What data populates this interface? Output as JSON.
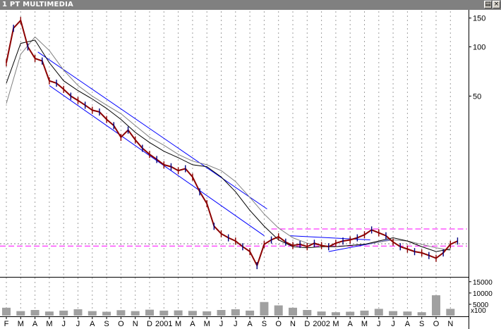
{
  "window": {
    "title": "1 PT MULTIMEDIA",
    "buttons": {
      "minimize": "▤",
      "close": "×"
    }
  },
  "chart_data": {
    "type": "line",
    "title": "1 PT MULTIMEDIA",
    "price_scale": "log",
    "price_ticks": [
      150,
      100,
      50
    ],
    "price_range": [
      4,
      165
    ],
    "volume_ticks": [
      15000,
      10000,
      5000
    ],
    "volume_multiplier_label": "x100",
    "x_labels": [
      "F",
      "M",
      "A",
      "M",
      "J",
      "J",
      "A",
      "S",
      "O",
      "N",
      "D",
      "2001",
      "M",
      "A",
      "M",
      "J",
      "J",
      "A",
      "S",
      "O",
      "N",
      "D",
      "2002",
      "M",
      "A",
      "M",
      "J",
      "J",
      "A",
      "S",
      "O",
      "N"
    ],
    "grid": "vertical-dotted",
    "series": [
      {
        "x": [
          0,
          0.5,
          1,
          1.5,
          2,
          2.5,
          3,
          3.5,
          4,
          4.5,
          5,
          5.5,
          6,
          6.5,
          7,
          7.5,
          8,
          8.5,
          9,
          9.5,
          10,
          10.5,
          11,
          11.5,
          12,
          12.5,
          13,
          13.5,
          14,
          14.5,
          15,
          15.5,
          16,
          16.5,
          17,
          17.5,
          18,
          18.5,
          19,
          19.5,
          20,
          20.5,
          21,
          21.5,
          22,
          22.5,
          23,
          23.5,
          24,
          24.5,
          25,
          25.5,
          26,
          26.5,
          27,
          27.5,
          28,
          28.5,
          29,
          29.5,
          30,
          30.5,
          31,
          31.5
        ],
        "values": [
          80,
          130,
          145,
          100,
          85,
          82,
          62,
          60,
          55,
          50,
          47,
          44,
          41,
          40,
          36,
          33,
          28,
          31,
          27,
          24,
          22,
          20.5,
          19,
          18.5,
          17.5,
          18,
          16,
          13,
          11,
          8,
          7.2,
          6.8,
          6.5,
          6.0,
          5.6,
          4.6,
          6.2,
          6.6,
          6.9,
          6.4,
          6.1,
          6.2,
          6.0,
          6.3,
          6.1,
          6.0,
          6.3,
          6.5,
          6.6,
          6.8,
          7.1,
          7.6,
          7.3,
          7.0,
          6.4,
          6.0,
          5.8,
          5.6,
          5.5,
          5.3,
          5.1,
          5.5,
          6.2,
          6.5
        ]
      },
      {
        "x": [
          0,
          1,
          2,
          3,
          4,
          5,
          6,
          7,
          8,
          9,
          10,
          11,
          12,
          13,
          14,
          15,
          16,
          17,
          18,
          19,
          20,
          21,
          22,
          23,
          24,
          25,
          26,
          27,
          28,
          29,
          30,
          31
        ],
        "values": [
          60,
          105,
          110,
          80,
          62,
          54,
          48,
          42,
          36,
          30,
          26,
          23,
          21,
          19,
          18.5,
          16,
          13,
          10,
          8,
          6.6,
          6.0,
          5.9,
          6.0,
          6.0,
          6.1,
          6.2,
          6.5,
          6.8,
          6.5,
          6.0,
          5.6,
          5.8
        ]
      },
      {
        "x": [
          0,
          1,
          2,
          3,
          4,
          5,
          6,
          7,
          8,
          9,
          10,
          11,
          12,
          13,
          14,
          15,
          16,
          17,
          18,
          19,
          20,
          21,
          22,
          23,
          24,
          25,
          26,
          27,
          28,
          29,
          30,
          31
        ],
        "values": [
          45,
          90,
          115,
          95,
          72,
          58,
          50,
          44,
          39,
          33,
          28,
          25,
          22,
          20,
          19,
          17.5,
          15,
          12,
          9.5,
          7.8,
          6.8,
          6.3,
          6.1,
          6.0,
          6.1,
          6.2,
          6.4,
          6.6,
          6.5,
          6.2,
          5.9,
          5.7
        ]
      }
    ],
    "volume": {
      "x": [
        0,
        1,
        2,
        3,
        4,
        5,
        6,
        7,
        8,
        9,
        10,
        11,
        12,
        13,
        14,
        15,
        16,
        17,
        18,
        19,
        20,
        21,
        22,
        23,
        24,
        25,
        26,
        27,
        28,
        29,
        30,
        31
      ],
      "values": [
        3500,
        2000,
        2500,
        1800,
        2200,
        2800,
        2000,
        1700,
        2400,
        2000,
        2600,
        2200,
        2300,
        2100,
        1900,
        2500,
        2800,
        2200,
        6000,
        4500,
        3500,
        2500,
        1800,
        1500,
        1700,
        2200,
        3000,
        2000,
        1800,
        1500,
        9000,
        3000
      ]
    },
    "annotations": {
      "channel_upper": [
        [
          2.2,
          93
        ],
        [
          18.2,
          10.2
        ]
      ],
      "channel_lower": [
        [
          3.0,
          58
        ],
        [
          18.0,
          7.0
        ]
      ],
      "triangle_upper": [
        [
          19.8,
          7.0
        ],
        [
          25.4,
          6.6
        ]
      ],
      "triangle_lower": [
        [
          22.5,
          5.6
        ],
        [
          26.8,
          6.6
        ]
      ],
      "resistance_level": 7.7,
      "support_level": 6.05,
      "support_dotted_level": 6.25
    },
    "colors": {
      "price": "#8b0000",
      "price_alt": "#000080",
      "ma_short": "#000000",
      "ma_long": "#808080",
      "trendline": "#0000ff",
      "level": "#ff00ff",
      "volume": "#a0a0a0",
      "grid": "#a0a0a0"
    }
  }
}
